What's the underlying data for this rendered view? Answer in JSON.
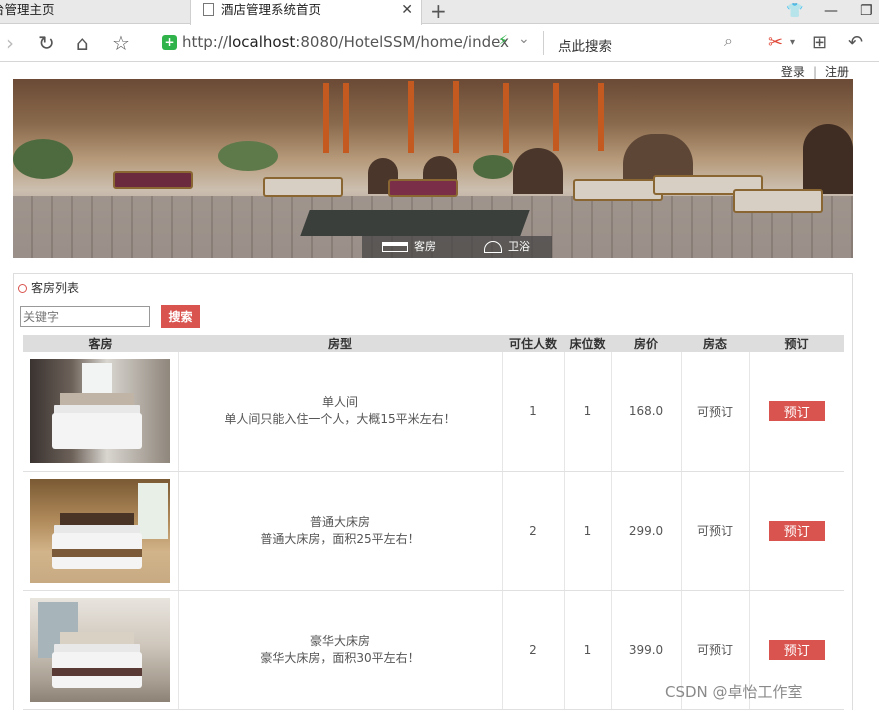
{
  "browser": {
    "tabs": [
      {
        "label": "台管理主页"
      },
      {
        "label": "酒店管理系统首页"
      }
    ],
    "url_prefix": "http://",
    "url_host": "localhost",
    "url_rest": ":8080/HotelSSM/home/index",
    "search_placeholder": "点此搜索"
  },
  "header": {
    "login_label": "登录",
    "separator": "|",
    "register_label": "注册"
  },
  "banner": {
    "nav": [
      {
        "label": "客房"
      },
      {
        "label": "卫浴"
      }
    ]
  },
  "room_list": {
    "title": "客房列表",
    "keyword_placeholder": "关键字",
    "search_label": "搜索",
    "columns": [
      "客房",
      "房型",
      "可住人数",
      "床位数",
      "房价",
      "房态",
      "预订"
    ],
    "rows": [
      {
        "name": "单人间",
        "desc": "单人间只能入住一个人，大概15平米左右！",
        "guests": "1",
        "beds": "1",
        "price": "168.0",
        "status": "可预订",
        "book_label": "预订"
      },
      {
        "name": "普通大床房",
        "desc": "普通大床房，面积25平左右！",
        "guests": "2",
        "beds": "1",
        "price": "299.0",
        "status": "可预订",
        "book_label": "预订"
      },
      {
        "name": "豪华大床房",
        "desc": "豪华大床房，面积30平左右！",
        "guests": "2",
        "beds": "1",
        "price": "399.0",
        "status": "可预订",
        "book_label": "预订"
      }
    ]
  },
  "watermark": "CSDN @卓怡工作室",
  "colors": {
    "accent": "#d9534f",
    "secure": "#2fb34a"
  }
}
